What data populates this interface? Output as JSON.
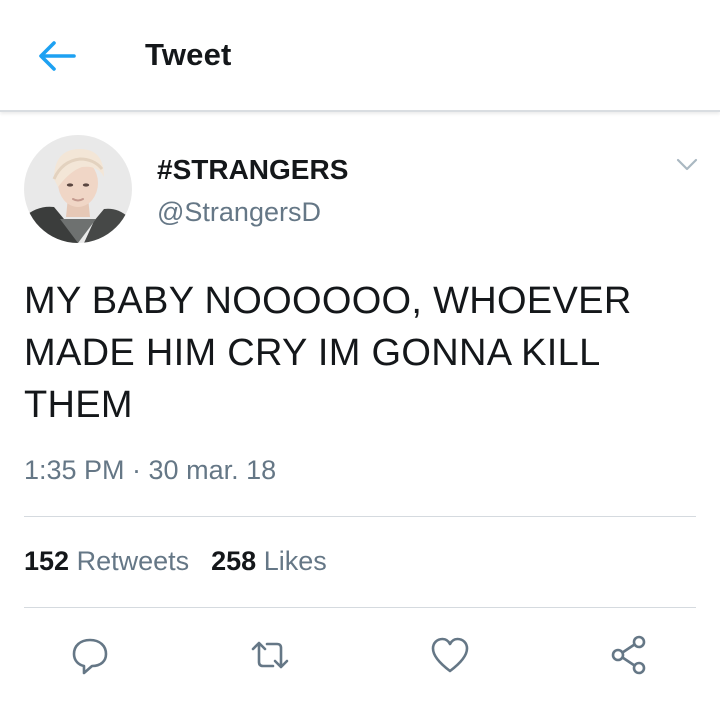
{
  "header": {
    "title": "Tweet",
    "back_icon": "arrow-left-icon",
    "accent": "#1da1f2"
  },
  "tweet": {
    "display_name": "#STRANGERS",
    "handle": "@StrangersD",
    "text": "MY BABY NOOOOOO, WHOEVER MADE HIM CRY IM GONNA KILL THEM",
    "timestamp": "1:35 PM · 30 mar. 18",
    "more_icon": "chevron-down-icon"
  },
  "stats": {
    "retweets_count": "152",
    "retweets_label": "Retweets",
    "likes_count": "258",
    "likes_label": "Likes"
  },
  "actions": [
    {
      "name": "reply",
      "icon": "reply-icon"
    },
    {
      "name": "retweet",
      "icon": "retweet-icon"
    },
    {
      "name": "like",
      "icon": "heart-icon"
    },
    {
      "name": "share",
      "icon": "share-icon"
    }
  ],
  "colors": {
    "text": "#14171a",
    "secondary": "#657786",
    "divider": "#d5dadf"
  }
}
